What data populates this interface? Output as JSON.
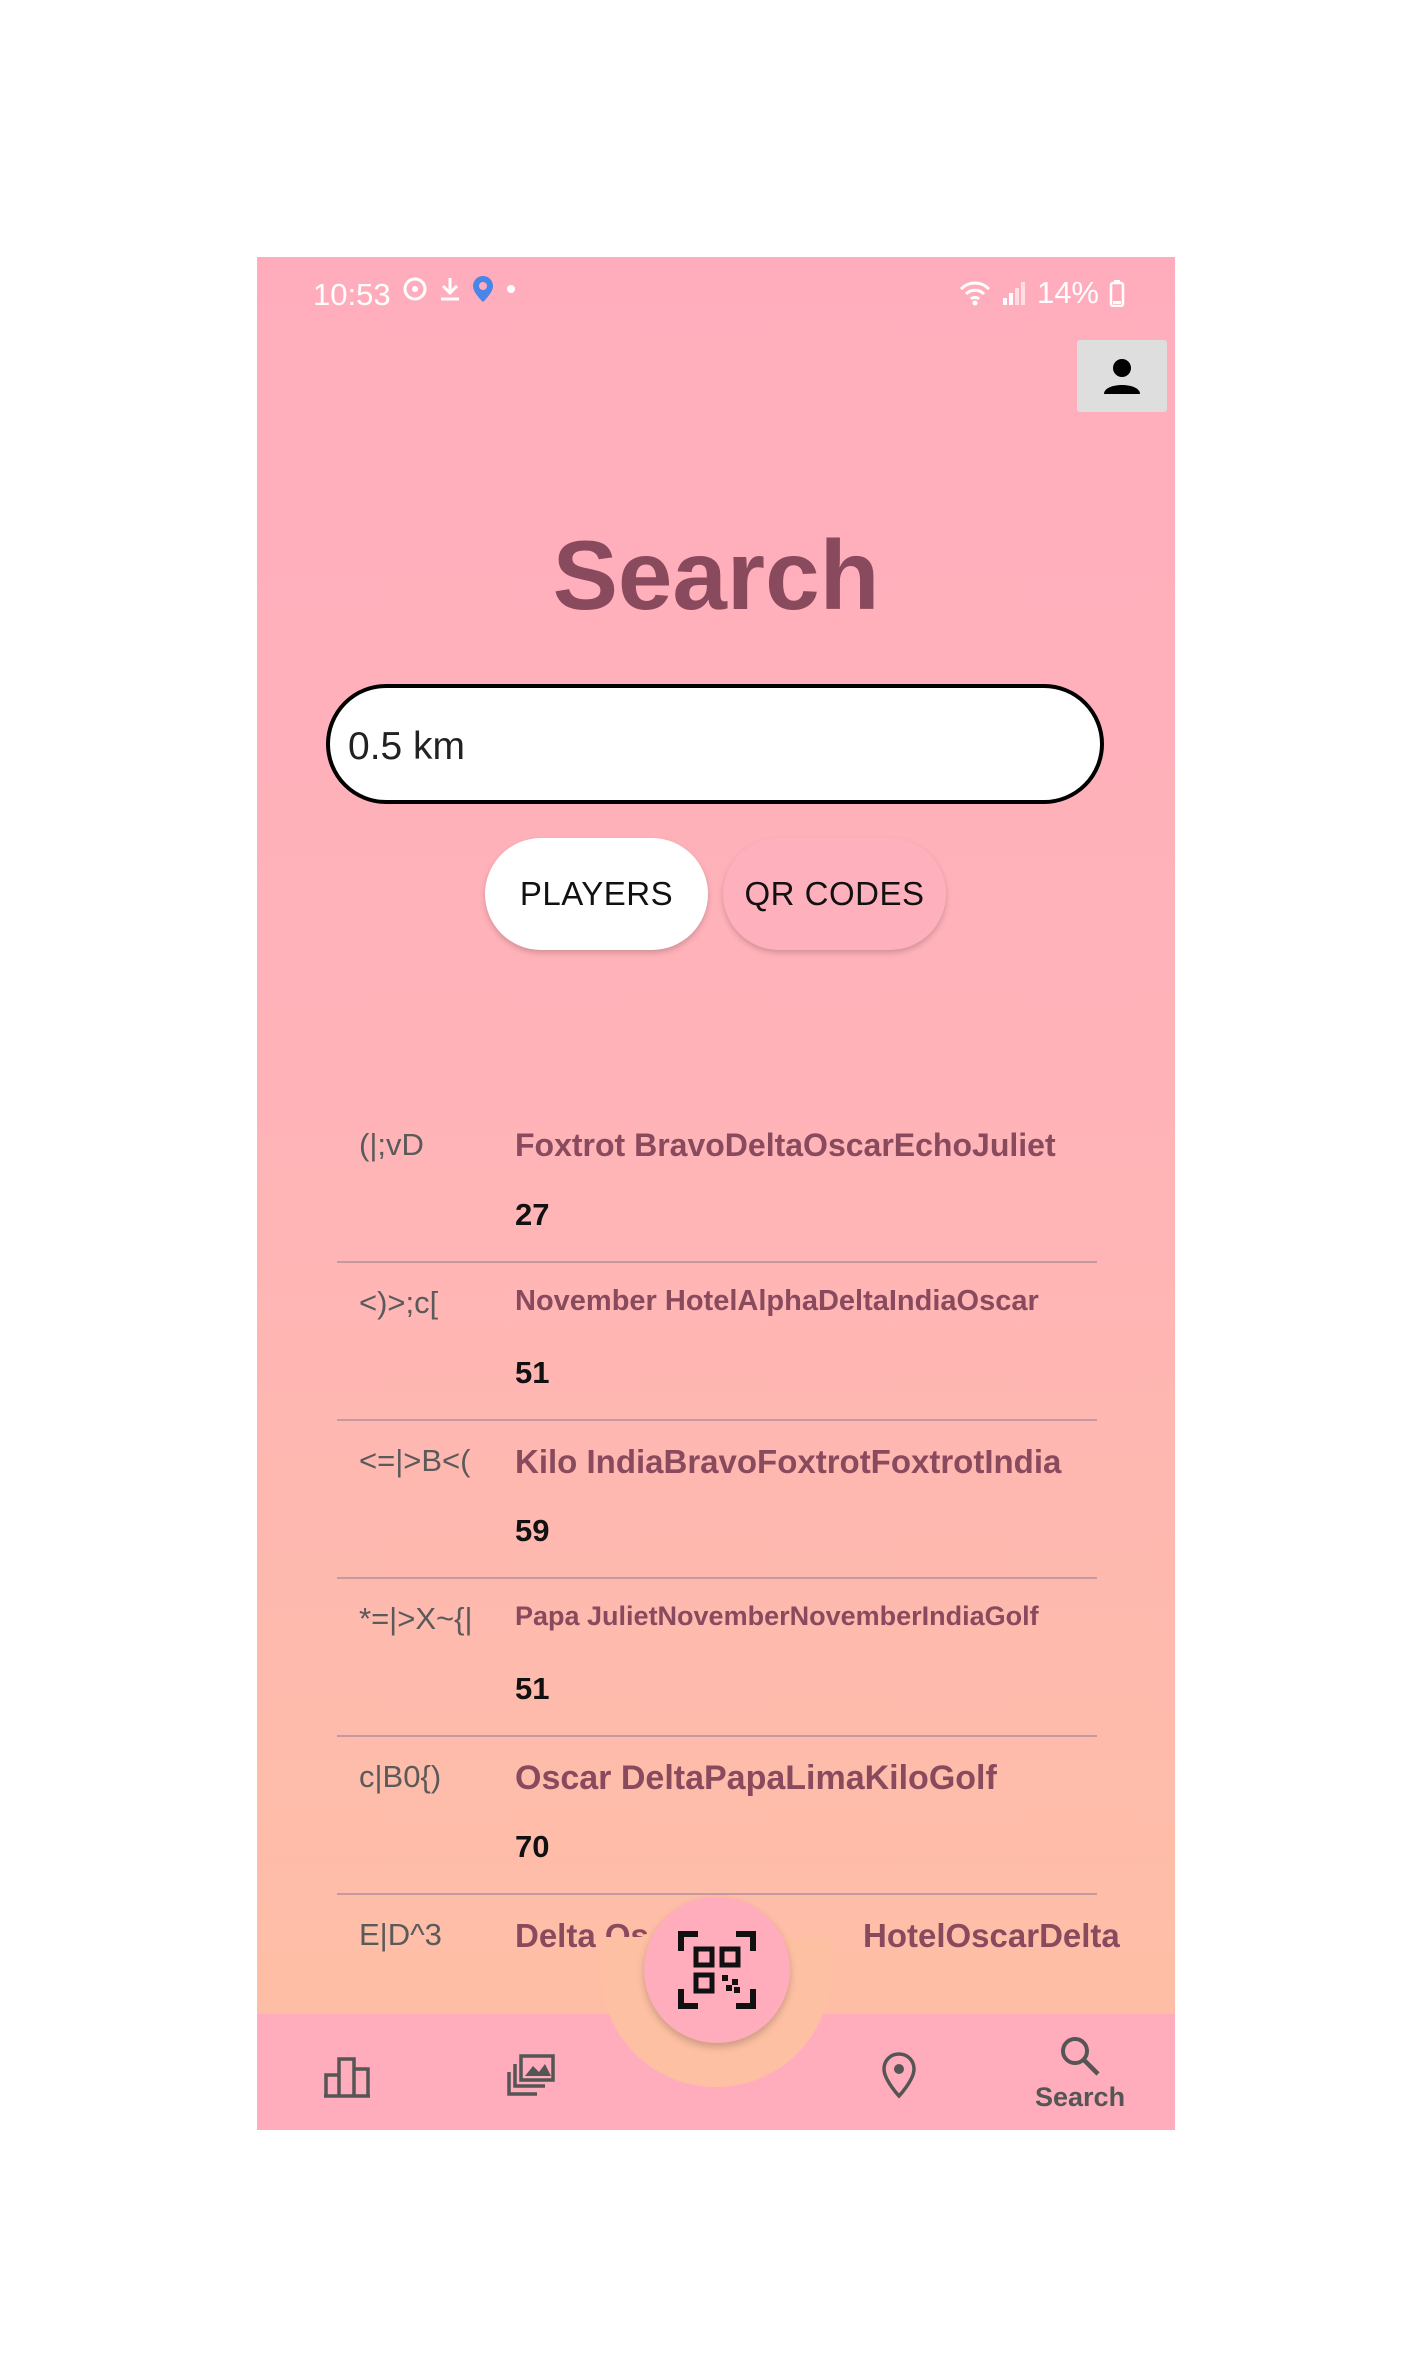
{
  "status_bar": {
    "time": "10:53",
    "battery": "14%"
  },
  "page": {
    "title": "Search"
  },
  "search": {
    "value": "0.5 km"
  },
  "toggle": {
    "players_label": "PLAYERS",
    "qr_codes_label": "QR CODES",
    "selected": "PLAYERS"
  },
  "results": [
    {
      "code": "(|;vD",
      "name": "Foxtrot BravoDeltaOscarEchoJuliet",
      "score": "27"
    },
    {
      "code": "<)>;c[",
      "name": "November HotelAlphaDeltaIndiaOscar",
      "score": "51"
    },
    {
      "code": "<=|>B<(",
      "name": "Kilo IndiaBravoFoxtrotFoxtrotIndia",
      "score": "59"
    },
    {
      "code": "*=|>X~{|",
      "name": "Papa JulietNovemberNovemberIndiaGolf",
      "score": "51"
    },
    {
      "code": "c|B0{)",
      "name": "Oscar DeltaPapaLimaKiloGolf",
      "score": "70"
    },
    {
      "code": "E|D^3",
      "name": "Delta Os",
      "name_tail": "HotelOscarDelta",
      "score": ""
    }
  ],
  "nav": {
    "search_label": "Search"
  },
  "colors": {
    "accent": "#8a4a5e",
    "nav_bg": "#ffadbd",
    "bg_top": "#ffadbd",
    "bg_bottom": "#fec0a3"
  },
  "icons": [
    "profile-icon",
    "leaderboard-icon",
    "collection-icon",
    "qr-scan-icon",
    "location-icon",
    "search-icon"
  ]
}
